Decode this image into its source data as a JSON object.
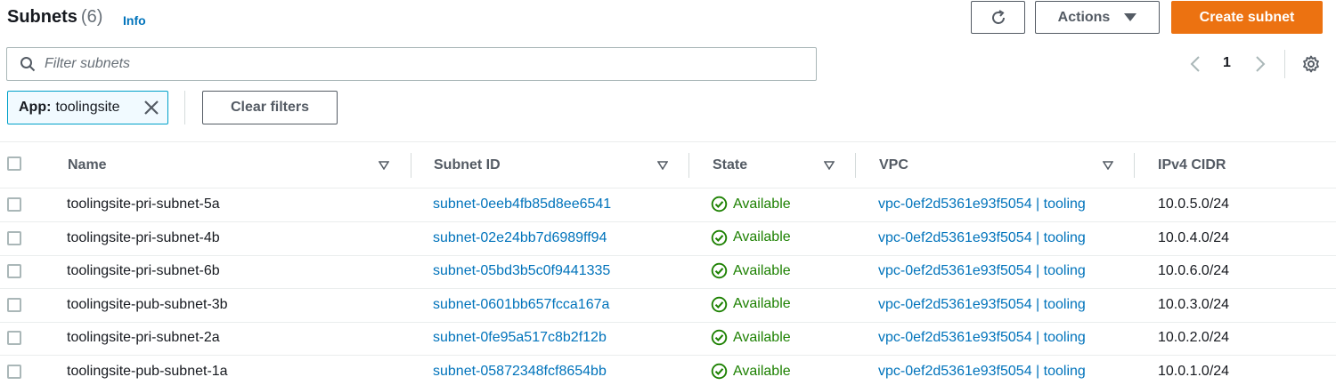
{
  "header": {
    "title": "Subnets",
    "count": "(6)",
    "info": "Info",
    "actions_label": "Actions",
    "create_label": "Create subnet"
  },
  "search": {
    "placeholder": "Filter subnets",
    "value": ""
  },
  "pagination": {
    "current_page": "1"
  },
  "filter_token": {
    "key": "App:",
    "value": "toolingsite"
  },
  "clear_filters_label": "Clear filters",
  "columns": [
    "Name",
    "Subnet ID",
    "State",
    "VPC",
    "IPv4 CIDR"
  ],
  "rows": [
    {
      "name": "toolingsite-pri-subnet-5a",
      "subnet_id": "subnet-0eeb4fb85d8ee6541",
      "state": "Available",
      "vpc": "vpc-0ef2d5361e93f5054 | tooling",
      "cidr": "10.0.5.0/24"
    },
    {
      "name": "toolingsite-pri-subnet-4b",
      "subnet_id": "subnet-02e24bb7d6989ff94",
      "state": "Available",
      "vpc": "vpc-0ef2d5361e93f5054 | tooling",
      "cidr": "10.0.4.0/24"
    },
    {
      "name": "toolingsite-pri-subnet-6b",
      "subnet_id": "subnet-05bd3b5c0f9441335",
      "state": "Available",
      "vpc": "vpc-0ef2d5361e93f5054 | tooling",
      "cidr": "10.0.6.0/24"
    },
    {
      "name": "toolingsite-pub-subnet-3b",
      "subnet_id": "subnet-0601bb657fcca167a",
      "state": "Available",
      "vpc": "vpc-0ef2d5361e93f5054 | tooling",
      "cidr": "10.0.3.0/24"
    },
    {
      "name": "toolingsite-pri-subnet-2a",
      "subnet_id": "subnet-0fe95a517c8b2f12b",
      "state": "Available",
      "vpc": "vpc-0ef2d5361e93f5054 | tooling",
      "cidr": "10.0.2.0/24"
    },
    {
      "name": "toolingsite-pub-subnet-1a",
      "subnet_id": "subnet-05872348fcf8654bb",
      "state": "Available",
      "vpc": "vpc-0ef2d5361e93f5054 | tooling",
      "cidr": "10.0.1.0/24"
    }
  ],
  "colors": {
    "accent": "#ec7211",
    "link": "#0073bb",
    "success": "#1d8102"
  },
  "icons": [
    "refresh-icon",
    "caret-down-icon",
    "search-icon",
    "chevron-left-icon",
    "chevron-right-icon",
    "gear-icon",
    "close-icon",
    "sort-caret-icon",
    "status-check-icon"
  ]
}
